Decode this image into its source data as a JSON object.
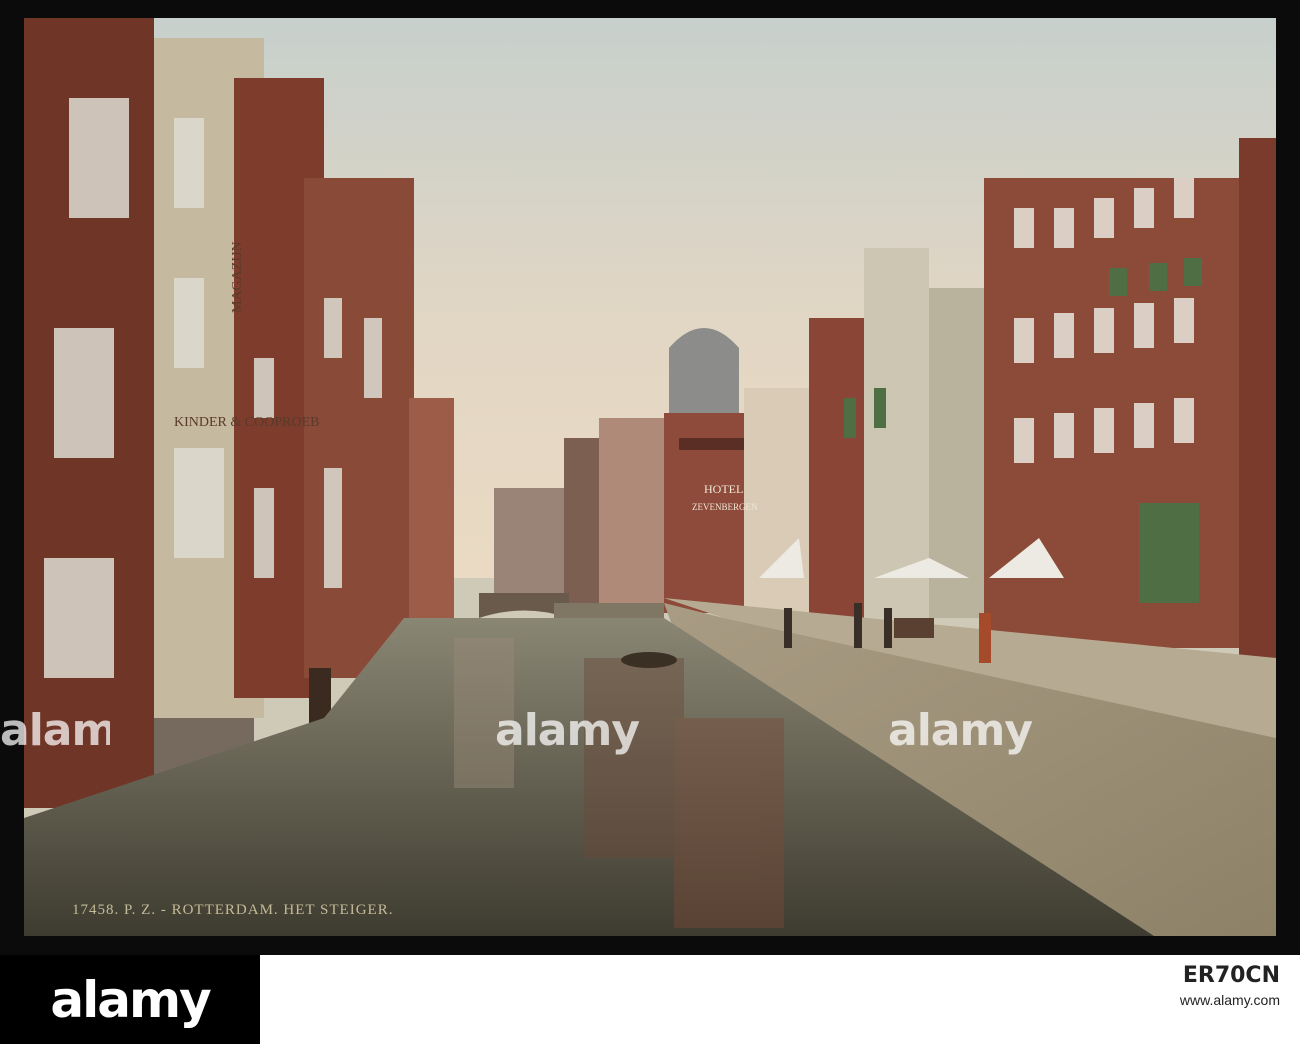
{
  "photo": {
    "caption": "17458. P. Z. - ROTTERDAM. HET STEIGER.",
    "signs": {
      "hotel": "HOTEL",
      "hotel_name": "ZEVENBERGEN",
      "left_building_1": "MAGAZIJN",
      "left_building_2": "KINDER & COOPROEB"
    }
  },
  "watermark": {
    "left": "alamy",
    "center": "alamy",
    "right": "alamy"
  },
  "stock_strip": {
    "logo": "alamy",
    "image_id": "ER70CN",
    "url": "www.alamy.com"
  },
  "colors": {
    "sky_top": "#cbd3cf",
    "sky_bottom": "#e8d8c4",
    "water": "#5c5a4a",
    "brick": "#7a3b2c",
    "frame": "#0b0b0b"
  }
}
